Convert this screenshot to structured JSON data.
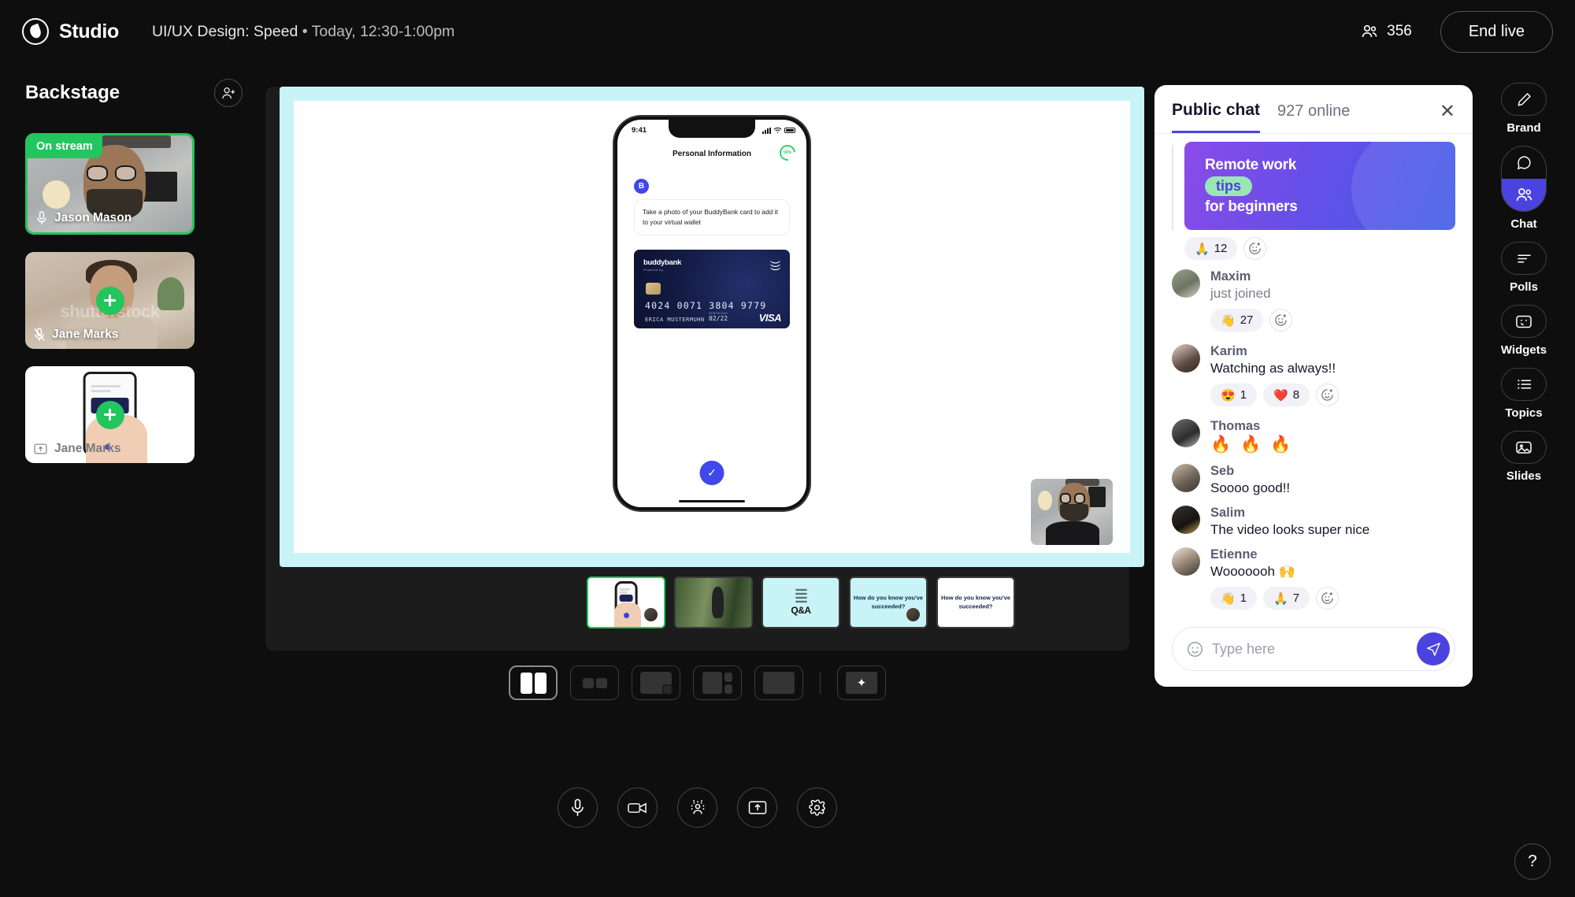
{
  "app": {
    "brand": "Studio",
    "brand_icon": "studio-logo-icon",
    "session_title": "UI/UX Design: Speed",
    "session_time": "Today, 12:30-1:00pm",
    "separator": "•",
    "viewer_count": "356",
    "viewers_icon": "people-icon",
    "end_live_label": "End live",
    "accent": "#4b43e0",
    "live_green": "#22c55e",
    "stage_cyan": "#c9f4f7"
  },
  "backstage": {
    "title": "Backstage",
    "add_person_icon": "add-person-icon",
    "cards": [
      {
        "name": "Jason Mason",
        "badge": "On stream",
        "mic_icon": "mic-on-icon",
        "on_stream": true
      },
      {
        "name": "Jane Marks",
        "badge": "",
        "mic_icon": "mic-off-icon",
        "on_stream": false
      },
      {
        "name": "Jane Marks",
        "badge": "",
        "mic_icon": "screen-share-icon",
        "on_stream": false
      }
    ]
  },
  "stage": {
    "phone": {
      "status_time": "9:41",
      "screen_title": "Personal Information",
      "progress_label": "50%",
      "avatar_initial": "B",
      "message": "Take a photo of your BuddyBank card to add it to your virtual wallet",
      "card": {
        "brand": "buddybank",
        "brand_sub": "Powered by",
        "number": "4024 0071 3804 9779",
        "exp_label": "MONTH/YEAR",
        "exp_prefix": "VALID THRU",
        "exp": "02/22",
        "holder": "ERICA MUSTERMUHN",
        "network": "VISA",
        "nfc_icon": "contactless-icon"
      },
      "confirm_icon": "check-icon"
    },
    "pip_name": "Jason Mason",
    "slides": [
      {
        "id": "slide-1",
        "label": "",
        "kind": "phone",
        "selected": true
      },
      {
        "id": "slide-2",
        "label": "",
        "kind": "runner",
        "selected": false
      },
      {
        "id": "slide-3",
        "label": "Q&A",
        "kind": "qa",
        "selected": false
      },
      {
        "id": "slide-4",
        "label": "How do you know you've succeeded?",
        "kind": "text",
        "selected": false
      },
      {
        "id": "slide-5",
        "label": "How do you know you've succeeded?",
        "kind": "text-white",
        "selected": false
      }
    ]
  },
  "layouts": [
    {
      "name": "layout-split-two",
      "icon": "split-two-icon",
      "active": true
    },
    {
      "name": "layout-two-small",
      "icon": "two-small-icon",
      "active": false
    },
    {
      "name": "layout-picture-in-picture",
      "icon": "pip-icon",
      "active": false
    },
    {
      "name": "layout-sidebar",
      "icon": "sidebar-icon",
      "active": false
    },
    {
      "name": "layout-full",
      "icon": "full-screen-icon",
      "active": false
    },
    {
      "name": "layout-auto",
      "icon": "sparkle-icon",
      "active": false
    }
  ],
  "controls": [
    {
      "name": "microphone-button",
      "icon": "mic-icon"
    },
    {
      "name": "camera-button",
      "icon": "camera-icon"
    },
    {
      "name": "effects-button",
      "icon": "person-effects-icon"
    },
    {
      "name": "share-screen-button",
      "icon": "share-screen-icon"
    },
    {
      "name": "settings-button",
      "icon": "gear-icon"
    }
  ],
  "chat": {
    "tab_label": "Public chat",
    "online_label": "927 online",
    "close_icon": "close-icon",
    "promo": {
      "line1": "Remote work",
      "line2": "tips",
      "line3": "for beginners",
      "reactions": [
        {
          "emoji": "🙏",
          "count": "12"
        }
      ],
      "add_reaction_icon": "add-reaction-icon"
    },
    "messages": [
      {
        "user": "Maxim",
        "text": "just joined",
        "muted": true,
        "emoji_only": false,
        "avatar": "avatar-maxim",
        "reactions": [
          {
            "emoji": "👋",
            "count": "27"
          }
        ]
      },
      {
        "user": "Karim",
        "text": "Watching as always!!",
        "muted": false,
        "emoji_only": false,
        "avatar": "avatar-karim",
        "reactions": [
          {
            "emoji": "😍",
            "count": "1"
          },
          {
            "emoji": "❤️",
            "count": "8"
          }
        ]
      },
      {
        "user": "Thomas",
        "text": "🔥 🔥 🔥",
        "muted": false,
        "emoji_only": true,
        "avatar": "avatar-thomas",
        "reactions": []
      },
      {
        "user": "Seb",
        "text": "Soooo good!!",
        "muted": false,
        "emoji_only": false,
        "avatar": "avatar-seb",
        "reactions": []
      },
      {
        "user": "Salim",
        "text": "The video looks super nice",
        "muted": false,
        "emoji_only": false,
        "avatar": "avatar-salim",
        "reactions": []
      },
      {
        "user": "Etienne",
        "text": "Wooooooh 🙌",
        "muted": false,
        "emoji_only": false,
        "avatar": "avatar-etienne",
        "reactions": [
          {
            "emoji": "👋",
            "count": "1"
          },
          {
            "emoji": "🙏",
            "count": "7"
          }
        ]
      }
    ],
    "composer": {
      "placeholder": "Type here",
      "emoji_icon": "emoji-icon",
      "send_icon": "send-icon"
    }
  },
  "rightnav": {
    "items": [
      {
        "label": "Brand",
        "icon": "pencil-icon",
        "active": false,
        "dual": false
      },
      {
        "label": "Chat",
        "icon": "chat-bubble-icon",
        "icon2": "people-icon",
        "active": true,
        "dual": true
      },
      {
        "label": "Polls",
        "icon": "poll-icon",
        "active": false,
        "dual": false
      },
      {
        "label": "Widgets",
        "icon": "widget-icon",
        "active": false,
        "dual": false
      },
      {
        "label": "Topics",
        "icon": "list-icon",
        "active": false,
        "dual": false
      },
      {
        "label": "Slides",
        "icon": "image-icon",
        "active": false,
        "dual": false
      }
    ],
    "help_label": "?"
  }
}
